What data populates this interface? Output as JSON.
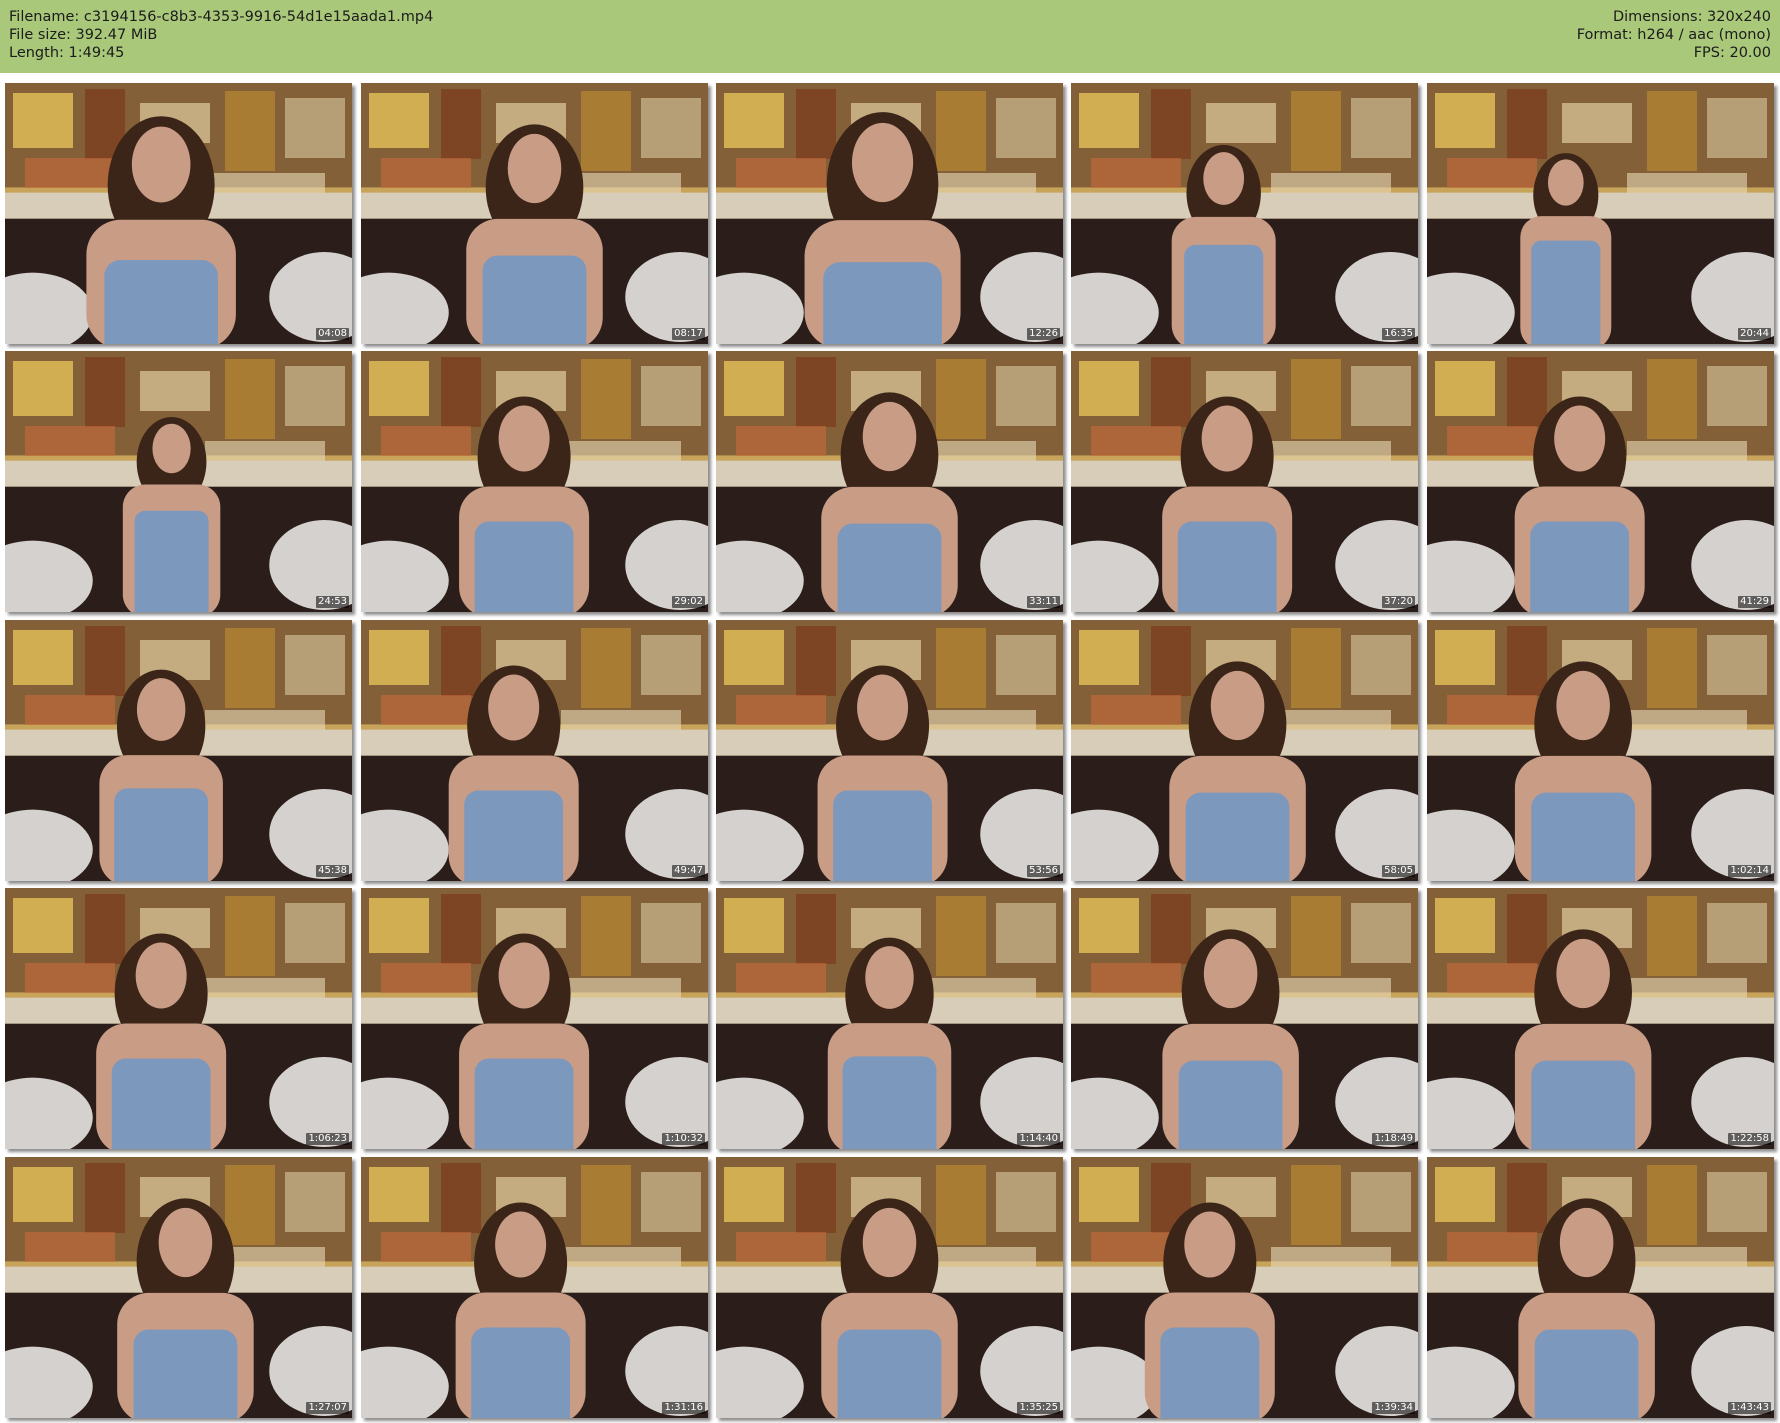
{
  "info": {
    "filename_line": "Filename: c3194156-c8b3-4353-9916-54d1e15aada1.mp4",
    "filesize_line": "File size: 392.47 MiB",
    "length_line": "Length: 1:49:45",
    "dimensions_line": "Dimensions: 320x240",
    "format_line": "Format: h264 / aac (mono)",
    "fps_line": "FPS: 20.00"
  },
  "colors": {
    "header_bg": "#a9c87a",
    "wall": "#c8a35a",
    "painting_dark": "#4a2a1c",
    "headboard": "#2a1d1a",
    "top": "#7d98bd",
    "skin": "#c99c86",
    "hair": "#3b2418",
    "bedding": "#e8e6e2"
  },
  "frames": [
    {
      "timestamp": "04:08"
    },
    {
      "timestamp": "08:17"
    },
    {
      "timestamp": "12:26"
    },
    {
      "timestamp": "16:35"
    },
    {
      "timestamp": "20:44"
    },
    {
      "timestamp": "24:53"
    },
    {
      "timestamp": "29:02"
    },
    {
      "timestamp": "33:11"
    },
    {
      "timestamp": "37:20"
    },
    {
      "timestamp": "41:29"
    },
    {
      "timestamp": "45:38"
    },
    {
      "timestamp": "49:47"
    },
    {
      "timestamp": "53:56"
    },
    {
      "timestamp": "58:05"
    },
    {
      "timestamp": "1:02:14"
    },
    {
      "timestamp": "1:06:23"
    },
    {
      "timestamp": "1:10:32"
    },
    {
      "timestamp": "1:14:40"
    },
    {
      "timestamp": "1:18:49"
    },
    {
      "timestamp": "1:22:58"
    },
    {
      "timestamp": "1:27:07"
    },
    {
      "timestamp": "1:31:16"
    },
    {
      "timestamp": "1:35:25"
    },
    {
      "timestamp": "1:39:34"
    },
    {
      "timestamp": "1:43:43"
    }
  ]
}
